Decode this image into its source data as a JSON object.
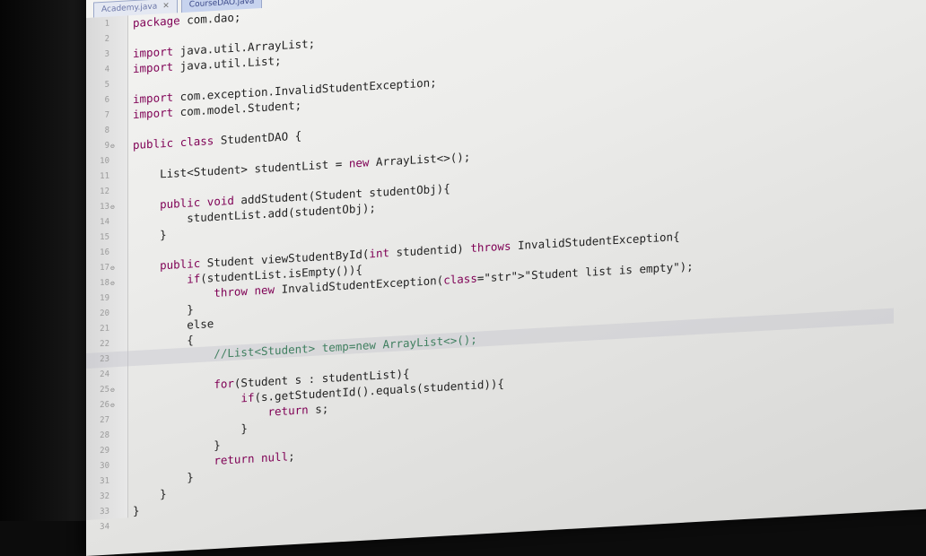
{
  "editor": {
    "tabs": [
      {
        "label": "Academy.java",
        "active": false
      },
      {
        "label": "CourseDAO.java",
        "active": true
      }
    ],
    "lines": [
      {
        "n": "1",
        "code": "package com.dao;"
      },
      {
        "n": "2",
        "code": ""
      },
      {
        "n": "3",
        "code": "import java.util.ArrayList;"
      },
      {
        "n": "4",
        "code": "import java.util.List;"
      },
      {
        "n": "5",
        "code": ""
      },
      {
        "n": "6",
        "code": "import com.exception.InvalidStudentException;"
      },
      {
        "n": "7",
        "code": "import com.model.Student;"
      },
      {
        "n": "8",
        "code": ""
      },
      {
        "n": "9",
        "code": "public class StudentDAO {"
      },
      {
        "n": "10",
        "code": ""
      },
      {
        "n": "11",
        "code": "    List<Student> studentList = new ArrayList<>();"
      },
      {
        "n": "12",
        "code": ""
      },
      {
        "n": "13",
        "code": "    public void addStudent(Student studentObj){"
      },
      {
        "n": "14",
        "code": "        studentList.add(studentObj);"
      },
      {
        "n": "15",
        "code": "    }"
      },
      {
        "n": "16",
        "code": ""
      },
      {
        "n": "17",
        "code": "    public Student viewStudentById(int studentid) throws InvalidStudentException{"
      },
      {
        "n": "18",
        "code": "        if(studentList.isEmpty()){"
      },
      {
        "n": "19",
        "code": "            throw new InvalidStudentException(\"Student list is empty\");"
      },
      {
        "n": "20",
        "code": "        }"
      },
      {
        "n": "21",
        "code": "        else"
      },
      {
        "n": "22",
        "code": "        {"
      },
      {
        "n": "23",
        "code": "            //List<Student> temp=new ArrayList<>();"
      },
      {
        "n": "24",
        "code": ""
      },
      {
        "n": "25",
        "code": "            for(Student s : studentList){"
      },
      {
        "n": "26",
        "code": "                if(s.getStudentId().equals(studentid)){"
      },
      {
        "n": "27",
        "code": "                    return s;"
      },
      {
        "n": "28",
        "code": "                }"
      },
      {
        "n": "29",
        "code": "            }"
      },
      {
        "n": "30",
        "code": "            return null;"
      },
      {
        "n": "31",
        "code": "        }"
      },
      {
        "n": "32",
        "code": "    }"
      },
      {
        "n": "33",
        "code": "}"
      },
      {
        "n": "34",
        "code": ""
      }
    ],
    "fold_markers": [
      "9",
      "13",
      "17",
      "18",
      "25",
      "26"
    ],
    "current_line": "23"
  }
}
